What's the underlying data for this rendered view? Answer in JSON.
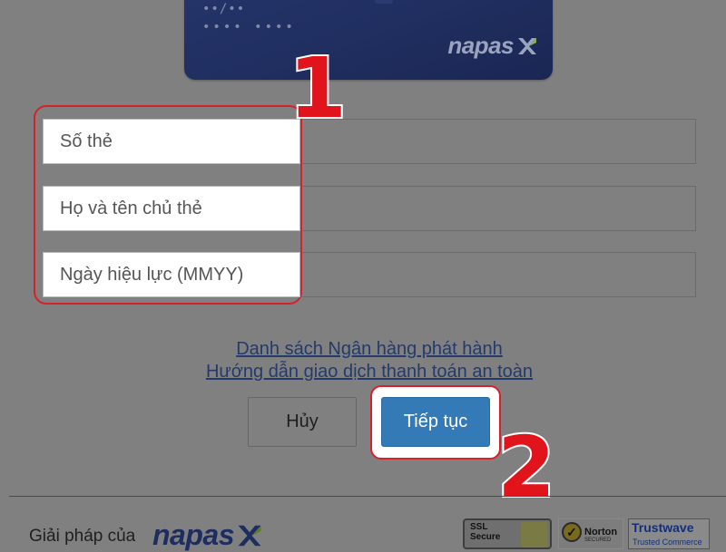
{
  "card": {
    "expiry_mask": "••/••",
    "number_mask": "•••• ••••",
    "brand": "napas"
  },
  "form": {
    "card_number_placeholder": "Số thẻ",
    "cardholder_name_placeholder": "Họ và tên chủ thẻ",
    "valid_from_placeholder": "Ngày hiệu lực (MMYY)"
  },
  "links": {
    "issuing_banks": "Danh sách Ngân hàng phát hành",
    "safe_payment_guide": "Hướng dẫn giao dịch thanh toán an toàn"
  },
  "buttons": {
    "cancel": "Hủy",
    "continue": "Tiếp tục"
  },
  "annotations": {
    "step1": "1",
    "step2": "2"
  },
  "footer": {
    "solution_by": "Giải pháp của",
    "brand": "napas",
    "ssl_line1": "SSL",
    "ssl_line2": "Secure",
    "norton": "Norton",
    "norton_sub": "SECURED",
    "trustwave": "Trustwave",
    "trustwave_sub": "Trusted Commerce"
  },
  "colors": {
    "overlay": "#808080",
    "accent_button": "#337ab7",
    "highlight_border": "#d8202a",
    "link": "#233a6b"
  }
}
